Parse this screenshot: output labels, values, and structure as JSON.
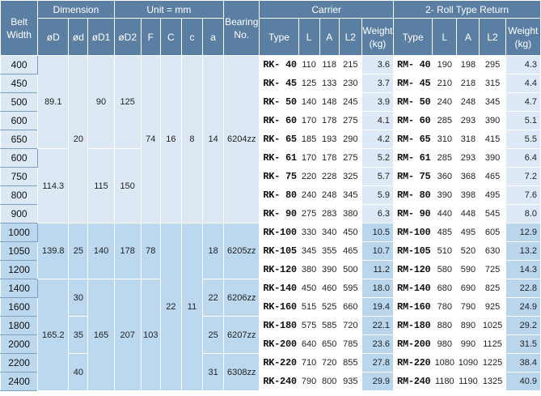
{
  "headers": {
    "belt_width": "Belt Width",
    "dimension": "Dimension",
    "unit": "Unit = mm",
    "bearing": "Bearing No.",
    "carrier": "Carrier",
    "return": "2- Roll Type Return",
    "dims": [
      "øD",
      "ød",
      "øD1",
      "øD2",
      "F",
      "C",
      "c",
      "a"
    ],
    "carrier_cols": [
      "Type",
      "L",
      "A",
      "L2",
      "Weight (kg)"
    ],
    "return_cols": [
      "Type",
      "L",
      "A",
      "L2",
      "Weight (kg)"
    ]
  },
  "merged": {
    "D_a": "89.1",
    "D_b": "114.3",
    "D_c": "139.8",
    "D_d": "165.2",
    "d_a": "20",
    "d_c": "25",
    "d_d1": "30",
    "d_d2": "35",
    "d_d3": "40",
    "D1_a": "90",
    "D1_b": "115",
    "D1_c": "140",
    "D1_d": "165",
    "D2_a": "125",
    "D2_b": "150",
    "D2_c": "178",
    "D2_d": "207",
    "F_a": "74",
    "F_c": "78",
    "F_d": "103",
    "C_a": "16",
    "C_c": "22",
    "c_a": "8",
    "c_c": "11",
    "a_a": "14",
    "a_c": "18",
    "a_d1": "22",
    "a_d2": "25",
    "a_d3": "31",
    "bearing_a": "6204zz",
    "bearing_c": "6205zz",
    "bearing_d1": "6206zz",
    "bearing_d2": "6207zz",
    "bearing_d3": "6308zz"
  },
  "rows": [
    {
      "belt": "400",
      "ct": "RK- 40",
      "cl": "110",
      "ca": "118",
      "cl2": "215",
      "cw": "3.6",
      "rt": "RM- 40",
      "rl": "190",
      "ra": "198",
      "rl2": "295",
      "rw": "4.3"
    },
    {
      "belt": "450",
      "ct": "RK- 45",
      "cl": "125",
      "ca": "133",
      "cl2": "230",
      "cw": "3.7",
      "rt": "RM- 45",
      "rl": "210",
      "ra": "218",
      "rl2": "315",
      "rw": "4.4"
    },
    {
      "belt": "500",
      "ct": "RK- 50",
      "cl": "140",
      "ca": "148",
      "cl2": "245",
      "cw": "3.9",
      "rt": "RM- 50",
      "rl": "240",
      "ra": "248",
      "rl2": "345",
      "rw": "4.7"
    },
    {
      "belt": "600",
      "ct": "RK- 60",
      "cl": "170",
      "ca": "178",
      "cl2": "275",
      "cw": "4.1",
      "rt": "RM- 60",
      "rl": "285",
      "ra": "293",
      "rl2": "390",
      "rw": "5.1"
    },
    {
      "belt": "650",
      "ct": "RK- 65",
      "cl": "185",
      "ca": "193",
      "cl2": "290",
      "cw": "4.2",
      "rt": "RM- 65",
      "rl": "310",
      "ra": "318",
      "rl2": "415",
      "rw": "5.5"
    },
    {
      "belt": "600",
      "ct": "RK- 61",
      "cl": "170",
      "ca": "178",
      "cl2": "275",
      "cw": "5.2",
      "rt": "RM- 61",
      "rl": "285",
      "ra": "293",
      "rl2": "390",
      "rw": "6.4"
    },
    {
      "belt": "750",
      "ct": "RK- 75",
      "cl": "220",
      "ca": "228",
      "cl2": "325",
      "cw": "5.7",
      "rt": "RM- 75",
      "rl": "360",
      "ra": "368",
      "rl2": "465",
      "rw": "7.2"
    },
    {
      "belt": "800",
      "ct": "RK- 80",
      "cl": "240",
      "ca": "248",
      "cl2": "345",
      "cw": "5.9",
      "rt": "RM- 80",
      "rl": "390",
      "ra": "398",
      "rl2": "495",
      "rw": "7.6"
    },
    {
      "belt": "900",
      "ct": "RK- 90",
      "cl": "275",
      "ca": "283",
      "cl2": "380",
      "cw": "6.3",
      "rt": "RM- 90",
      "rl": "440",
      "ra": "448",
      "rl2": "545",
      "rw": "8.0"
    },
    {
      "belt": "1000",
      "ct": "RK-100",
      "cl": "330",
      "ca": "340",
      "cl2": "450",
      "cw": "10.5",
      "rt": "RM-100",
      "rl": "485",
      "ra": "495",
      "rl2": "605",
      "rw": "12.9"
    },
    {
      "belt": "1050",
      "ct": "RK-105",
      "cl": "345",
      "ca": "355",
      "cl2": "465",
      "cw": "10.7",
      "rt": "RM-105",
      "rl": "510",
      "ra": "520",
      "rl2": "630",
      "rw": "13.2"
    },
    {
      "belt": "1200",
      "ct": "RK-120",
      "cl": "380",
      "ca": "390",
      "cl2": "500",
      "cw": "11.2",
      "rt": "RM-120",
      "rl": "580",
      "ra": "590",
      "rl2": "725",
      "rw": "14.3"
    },
    {
      "belt": "1400",
      "ct": "RK-140",
      "cl": "450",
      "ca": "460",
      "cl2": "595",
      "cw": "18.0",
      "rt": "RM-140",
      "rl": "680",
      "ra": "690",
      "rl2": "825",
      "rw": "22.8"
    },
    {
      "belt": "1600",
      "ct": "RK-160",
      "cl": "515",
      "ca": "525",
      "cl2": "660",
      "cw": "19.4",
      "rt": "RM-160",
      "rl": "780",
      "ra": "790",
      "rl2": "925",
      "rw": "24.9"
    },
    {
      "belt": "1800",
      "ct": "RK-180",
      "cl": "575",
      "ca": "585",
      "cl2": "720",
      "cw": "22.1",
      "rt": "RM-180",
      "rl": "880",
      "ra": "890",
      "rl2": "1025",
      "rw": "29.2"
    },
    {
      "belt": "2000",
      "ct": "RK-200",
      "cl": "640",
      "ca": "650",
      "cl2": "785",
      "cw": "23.6",
      "rt": "RM-200",
      "rl": "980",
      "ra": "990",
      "rl2": "1125",
      "rw": "31.5"
    },
    {
      "belt": "2200",
      "ct": "RK-220",
      "cl": "710",
      "ca": "720",
      "cl2": "855",
      "cw": "27.8",
      "rt": "RM-220",
      "rl": "1080",
      "ra": "1090",
      "rl2": "1225",
      "rw": "38.4"
    },
    {
      "belt": "2400",
      "ct": "RK-240",
      "cl": "790",
      "ca": "800",
      "cl2": "935",
      "cw": "29.9",
      "rt": "RM-240",
      "rl": "1180",
      "ra": "1190",
      "rl2": "1325",
      "rw": "40.9"
    }
  ]
}
